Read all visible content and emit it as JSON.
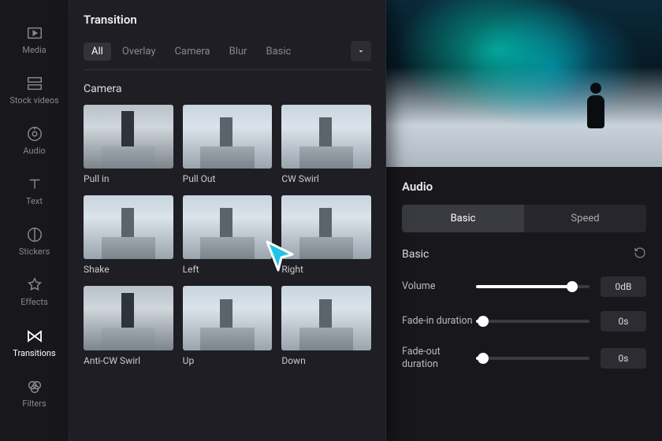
{
  "sidebar": {
    "items": [
      {
        "label": "Media",
        "icon": "media-icon"
      },
      {
        "label": "Stock videos",
        "icon": "stock-icon"
      },
      {
        "label": "Audio",
        "icon": "audio-icon"
      },
      {
        "label": "Text",
        "icon": "text-icon"
      },
      {
        "label": "Stickers",
        "icon": "stickers-icon"
      },
      {
        "label": "Effects",
        "icon": "effects-icon"
      },
      {
        "label": "Transitions",
        "icon": "transitions-icon",
        "active": true
      },
      {
        "label": "Filters",
        "icon": "filters-icon"
      }
    ]
  },
  "panel": {
    "title": "Transition",
    "tabs": [
      "All",
      "Overlay",
      "Camera",
      "Blur",
      "Basic"
    ],
    "active_tab": "All",
    "section": "Camera",
    "items": [
      {
        "label": "Pull in"
      },
      {
        "label": "Pull Out"
      },
      {
        "label": "CW Swirl"
      },
      {
        "label": "Shake"
      },
      {
        "label": "Left"
      },
      {
        "label": "Right"
      },
      {
        "label": "Anti-CW Swirl"
      },
      {
        "label": "Up"
      },
      {
        "label": "Down"
      }
    ]
  },
  "audio": {
    "title": "Audio",
    "segments": [
      "Basic",
      "Speed"
    ],
    "active_segment": "Basic",
    "sub_title": "Basic",
    "controls": {
      "volume": {
        "label": "Volume",
        "value": "0dB",
        "pct": 85
      },
      "fade_in": {
        "label": "Fade-in duration",
        "value": "0s",
        "pct": 6
      },
      "fade_out": {
        "label": "Fade-out duration",
        "value": "0s",
        "pct": 6
      }
    }
  }
}
